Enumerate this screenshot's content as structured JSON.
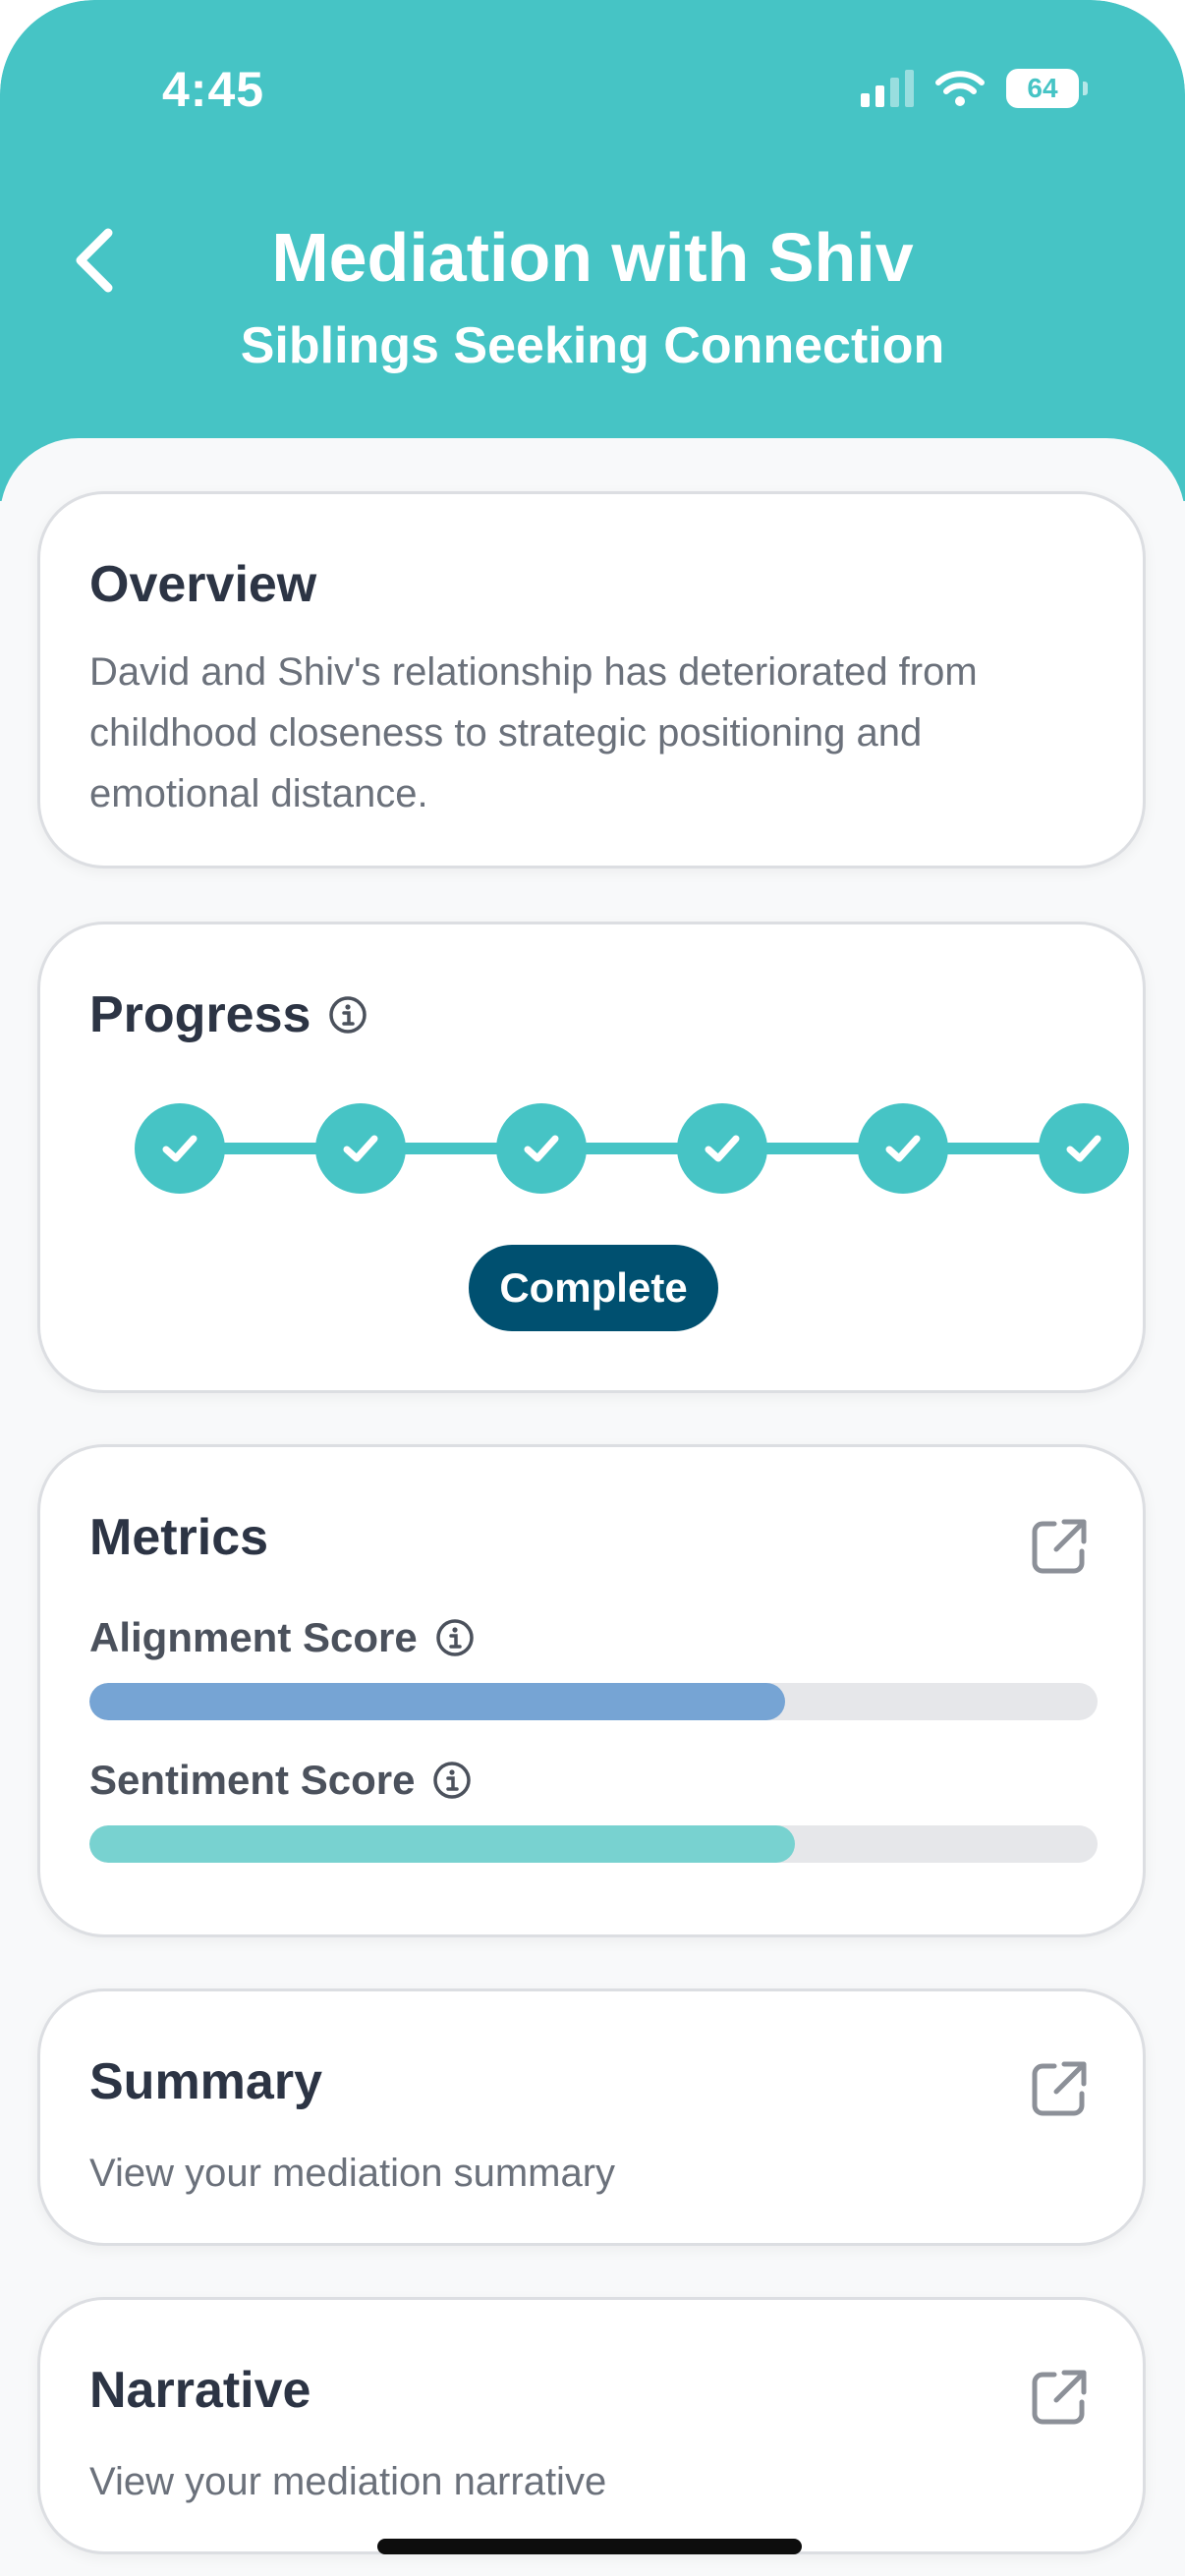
{
  "status_bar": {
    "time": "4:45",
    "battery": "64",
    "icons": [
      "signal-icon",
      "wifi-icon",
      "battery-icon"
    ]
  },
  "header": {
    "back_icon": "chevron-left-icon",
    "title": "Mediation with Shiv",
    "subtitle": "Siblings Seeking Connection"
  },
  "overview": {
    "title": "Overview",
    "lines": [
      "David and Shiv's relationship has deteriorated from",
      "childhood closeness to strategic positioning and",
      "emotional distance."
    ]
  },
  "progress": {
    "title": "Progress",
    "info_icon": "info-icon",
    "steps_completed": 6,
    "steps_total": 6,
    "step_icon": "check-icon",
    "status": "Complete"
  },
  "metrics": {
    "title": "Metrics",
    "open_icon": "external-link-icon",
    "items": [
      {
        "label": "Alignment Score",
        "value": 0.69,
        "color": "#76a4d4"
      },
      {
        "label": "Sentiment Score",
        "value": 0.7,
        "color": "#78d2d0"
      }
    ]
  },
  "summary": {
    "title": "Summary",
    "description": "View your mediation summary",
    "open_icon": "external-link-icon"
  },
  "narrative": {
    "title": "Narrative",
    "description": "View your mediation narrative",
    "open_icon": "external-link-icon"
  },
  "colors": {
    "accent": "#46c4c5",
    "badge": "#005070",
    "text_primary": "#2c3444",
    "text_secondary": "#6b717b"
  }
}
